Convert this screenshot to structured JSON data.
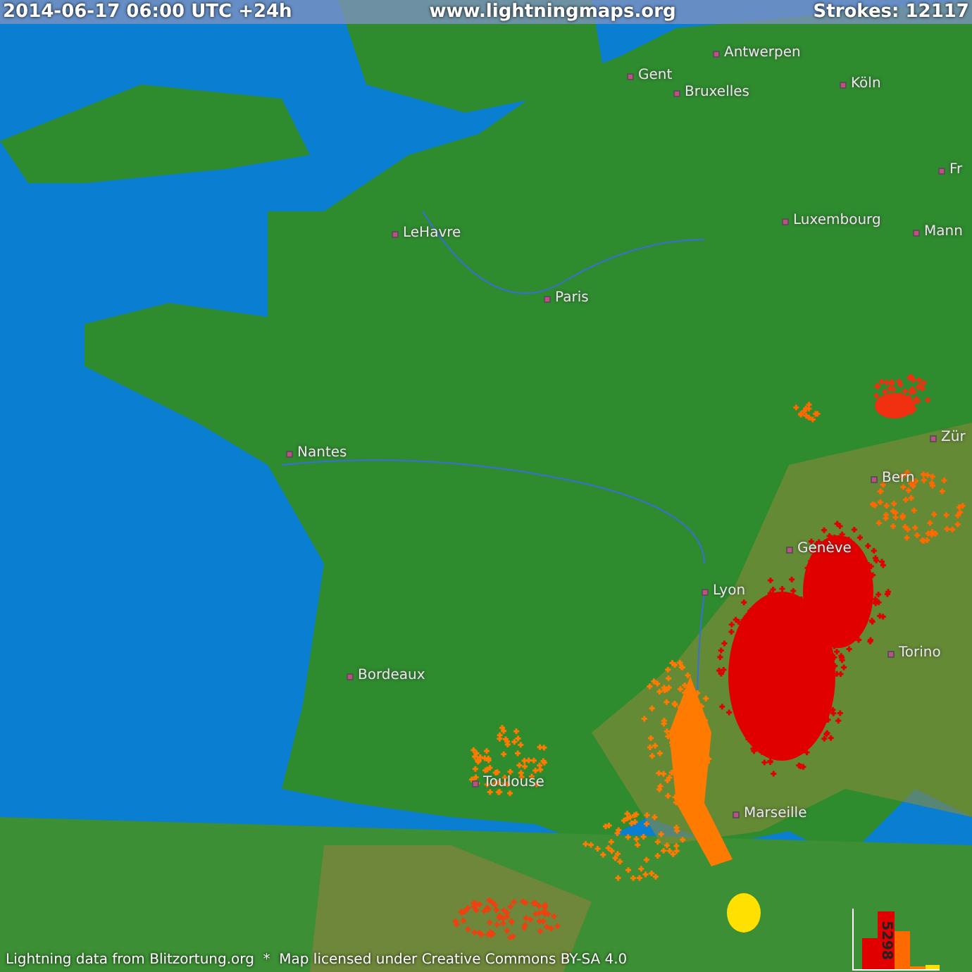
{
  "header": {
    "timestamp": "2014-06-17 06:00 UTC +24h",
    "site": "www.lightningmaps.org",
    "strokes": "Strokes: 12117"
  },
  "cities": [
    {
      "name": "Antwerpen"
    },
    {
      "name": "Gent"
    },
    {
      "name": "Bruxelles"
    },
    {
      "name": "Köln"
    },
    {
      "name": "LeHavre"
    },
    {
      "name": "Paris"
    },
    {
      "name": "Luxembourg"
    },
    {
      "name": "Fr"
    },
    {
      "name": "Mann"
    },
    {
      "name": "Nantes"
    },
    {
      "name": "Zür"
    },
    {
      "name": "Bern"
    },
    {
      "name": "Genève"
    },
    {
      "name": "Lyon"
    },
    {
      "name": "Torino"
    },
    {
      "name": "Bordeaux"
    },
    {
      "name": "Toulouse"
    },
    {
      "name": "Marseille"
    }
  ],
  "histogram": {
    "peak_label": "5298"
  },
  "footer": {
    "credit": "Lightning data from Blitzortung.org  *  Map licensed under Creative Commons BY-SA 4.0"
  }
}
